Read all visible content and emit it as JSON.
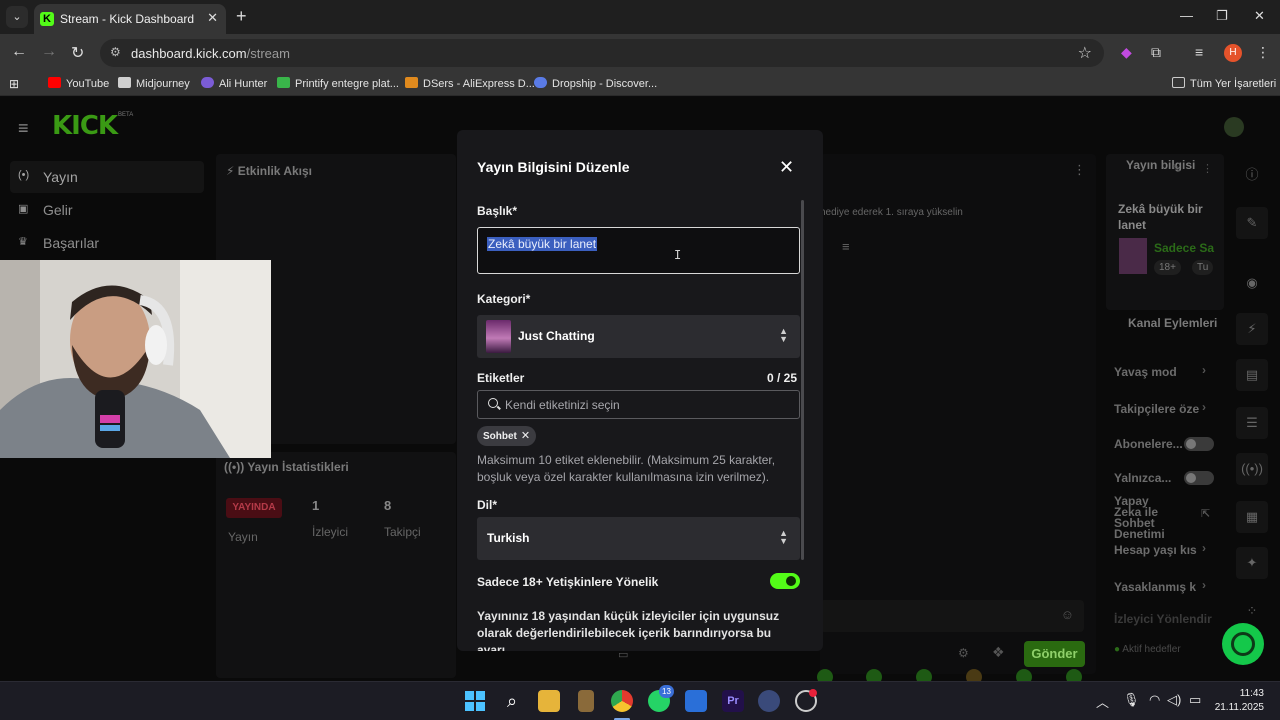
{
  "browser": {
    "tab_title": "Stream - Kick Dashboard",
    "url_host": "dashboard.kick.com",
    "url_path": "/stream",
    "profile_initial": "H",
    "bookmarks": [
      "YouTube",
      "Midjourney",
      "Ali Hunter",
      "Printify entegre plat...",
      "DSers - AliExpress D...",
      "Dropship - Discover..."
    ],
    "all_bookmarks": "Tüm Yer İşaretleri"
  },
  "sidebar": {
    "logo": "KICK",
    "logo_badge": "BETA",
    "items": [
      {
        "label": "Yayın",
        "icon": "broadcast-icon"
      },
      {
        "label": "Gelir",
        "icon": "revenue-icon"
      },
      {
        "label": "Başarılar",
        "icon": "trophy-icon"
      }
    ]
  },
  "panels": {
    "activity_title": "Etkinlik Akışı",
    "stats_title": "Yayın İstatistikleri",
    "live_badge": "YAYINDA",
    "live_label": "Yayın",
    "viewers_value": "1",
    "viewers_label": "İzleyici",
    "followers_value": "8",
    "followers_label": "Takipçi",
    "chat_promo": "hediye ederek 1. sıraya yükselin",
    "send_label": "Gönder"
  },
  "right_panel": {
    "stream_info_title": "Yayın bilgisi",
    "stream_title": "Zekâ büyük bir lanet",
    "audience": "Sadece Sa",
    "tag_18": "18+",
    "tag_tu": "Tu",
    "channel_actions_title": "Kanal Eylemleri",
    "actions": [
      "Yavaş mod",
      "Takipçilere öze",
      "Abonelere...",
      "Yalnızca...",
      "Yapay Zeka ile Sohbet Denetimi",
      "Hesap yaşı kıs",
      "Yasaklanmış k",
      "İzleyici Yönlendir"
    ],
    "active_goals": "Aktif hedefler"
  },
  "modal": {
    "title": "Yayın Bilgisini Düzenle",
    "title_label": "Başlık*",
    "title_value": "Zekâ büyük bir lanet",
    "category_label": "Kategori*",
    "category_value": "Just Chatting",
    "tags_label": "Etiketler",
    "tags_counter": "0 / 25",
    "tags_placeholder": "Kendi etiketinizi seçin",
    "tag_chip": "Sohbet",
    "tags_help": "Maksimum 10 etiket eklenebilir. (Maksimum 25 karakter, boşluk veya özel karakter kullanılmasına izin verilmez).",
    "language_label": "Dil*",
    "language_value": "Turkish",
    "adult_label": "Sadece 18+ Yetişkinlere Yönelik",
    "adult_enabled": true,
    "adult_desc": "Yayınınız 18 yaşından küçük izleyiciler için uygunsuz olarak değerlendirilebilecek içerik barındırıyorsa bu ayarı"
  },
  "taskbar": {
    "time": "11:43",
    "date": "21.11.2025",
    "whatsapp_badge": "13"
  },
  "colors": {
    "kick_green": "#53fc18",
    "modal_bg": "#18181b",
    "selection_blue": "#3b5fbf"
  }
}
